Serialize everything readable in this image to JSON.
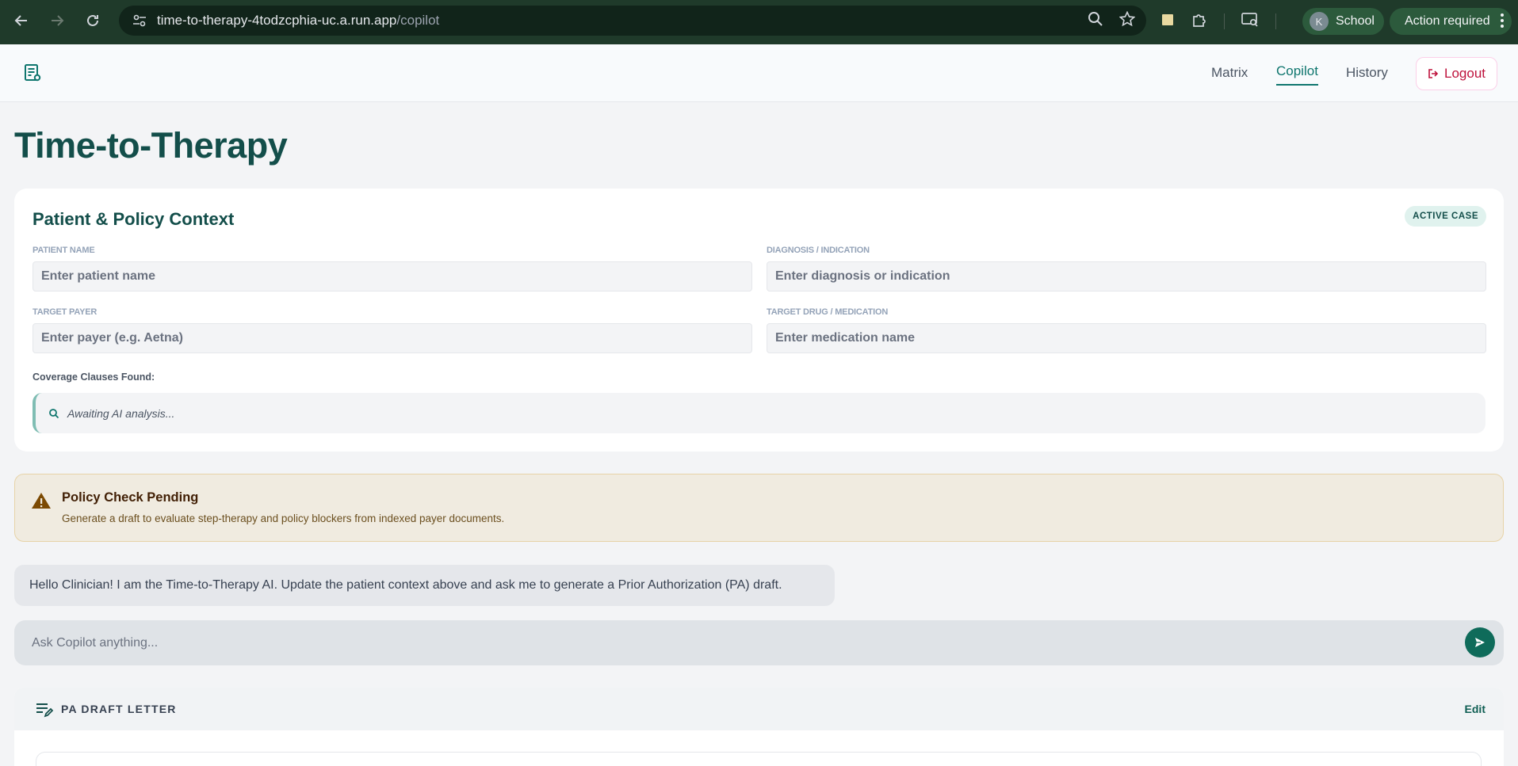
{
  "browser": {
    "url_host": "time-to-therapy-4todzcphia-uc.a.run.app",
    "url_path": "/copilot",
    "profile_initial": "K",
    "profile_name": "School",
    "action_label": "Action required"
  },
  "header": {
    "nav": [
      {
        "label": "Matrix",
        "active": false
      },
      {
        "label": "Copilot",
        "active": true
      },
      {
        "label": "History",
        "active": false
      }
    ],
    "logout_label": "Logout"
  },
  "page": {
    "title": "Time-to-Therapy"
  },
  "context_card": {
    "title": "Patient & Policy Context",
    "badge": "ACTIVE CASE",
    "fields": {
      "patient_name": {
        "label": "PATIENT NAME",
        "placeholder": "Enter patient name",
        "value": ""
      },
      "diagnosis": {
        "label": "DIAGNOSIS / INDICATION",
        "placeholder": "Enter diagnosis or indication",
        "value": ""
      },
      "payer": {
        "label": "TARGET PAYER",
        "placeholder": "Enter payer (e.g. Aetna)",
        "value": ""
      },
      "drug": {
        "label": "TARGET DRUG / MEDICATION",
        "placeholder": "Enter medication name",
        "value": ""
      }
    },
    "clauses_label": "Coverage Clauses Found:",
    "clauses_status": "Awaiting AI analysis..."
  },
  "policy_banner": {
    "title": "Policy Check Pending",
    "text": "Generate a draft to evaluate step-therapy and policy blockers from indexed payer documents."
  },
  "chat": {
    "assistant_message": "Hello Clinician! I am the Time-to-Therapy AI. Update the patient context above and ask me to generate a Prior Authorization (PA) draft.",
    "input_placeholder": "Ask Copilot anything..."
  },
  "draft_letter": {
    "title": "PA DRAFT LETTER",
    "edit_label": "Edit"
  },
  "colors": {
    "brand": "#0f766e",
    "brand_dark": "#134e4a",
    "warning_bg": "#f0ebe0",
    "logout": "#be123c"
  }
}
